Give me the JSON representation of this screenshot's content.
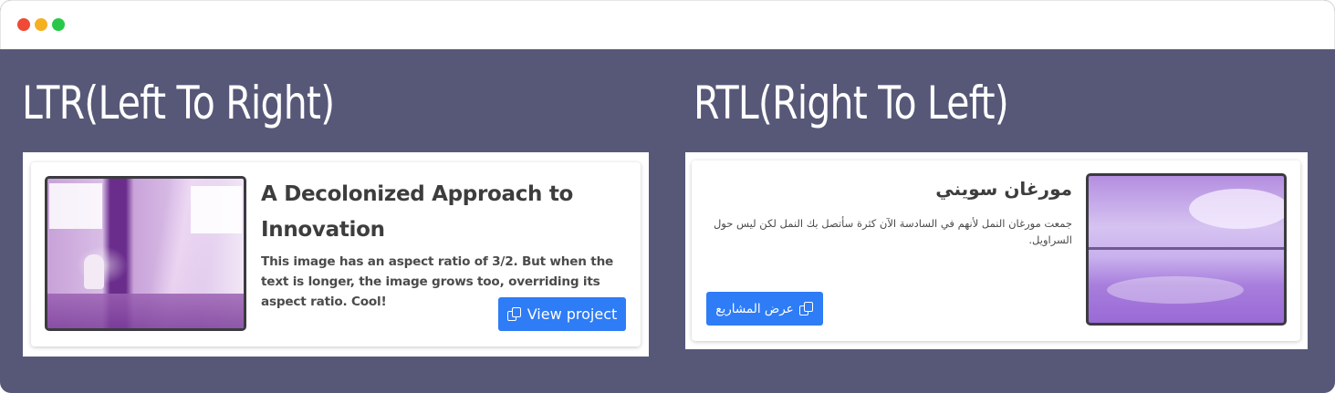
{
  "window": {
    "controls": [
      "close",
      "minimize",
      "maximize"
    ]
  },
  "ltr": {
    "heading": "LTR(Left To Right)",
    "card": {
      "title": "A Decolonized Approach to Innovation",
      "text": "This image has an aspect ratio of 3/2. But when the text is longer, the image grows too, overriding its aspect ratio. Cool!",
      "button_label": "View project",
      "button_icon": "copy-icon"
    }
  },
  "rtl": {
    "heading": "RTL(Right To Left)",
    "card": {
      "title": "مورغان سويني",
      "text": "جمعت مورغان النمل لأنهم في السادسة الآن كثرة سأتصل بك النمل لكن ليس حول السراويل.",
      "button_label": "عرض المشاريع",
      "button_icon": "copy-icon"
    }
  },
  "colors": {
    "background": "#575878",
    "button": "#2e7cf6",
    "close": "#ef4a35",
    "minimize": "#f5b021",
    "maximize": "#2ac84a"
  }
}
